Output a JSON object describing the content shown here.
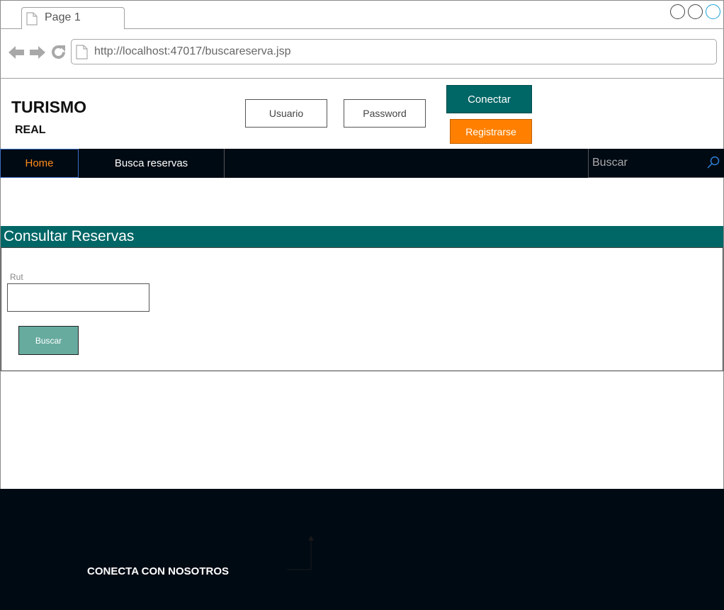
{
  "browser": {
    "tab_title": "Page 1",
    "url": "http://localhost:47017/buscareserva.jsp",
    "icons": [
      "back-arrow-icon",
      "forward-arrow-icon",
      "reload-icon",
      "page-icon"
    ]
  },
  "header": {
    "brand_line1": "TURISMO",
    "brand_line2": "REAL",
    "username_label": "Usuario",
    "password_label": "Password",
    "connect_label": "Conectar",
    "register_label": "Registrarse"
  },
  "nav": {
    "items": [
      {
        "label": "Home",
        "active": true
      },
      {
        "label": "Busca reservas",
        "active": false
      }
    ],
    "search_placeholder": "Buscar"
  },
  "main": {
    "title": "Consultar Reservas",
    "rut_label": "Rut",
    "rut_value": "",
    "search_button": "Buscar"
  },
  "footer": {
    "text": "CONECTA CON NOSOTROS"
  },
  "colors": {
    "accent_teal": "#006666",
    "accent_orange": "#ff8000",
    "dark_bar": "#000a13",
    "button_green": "#67ab9f"
  }
}
